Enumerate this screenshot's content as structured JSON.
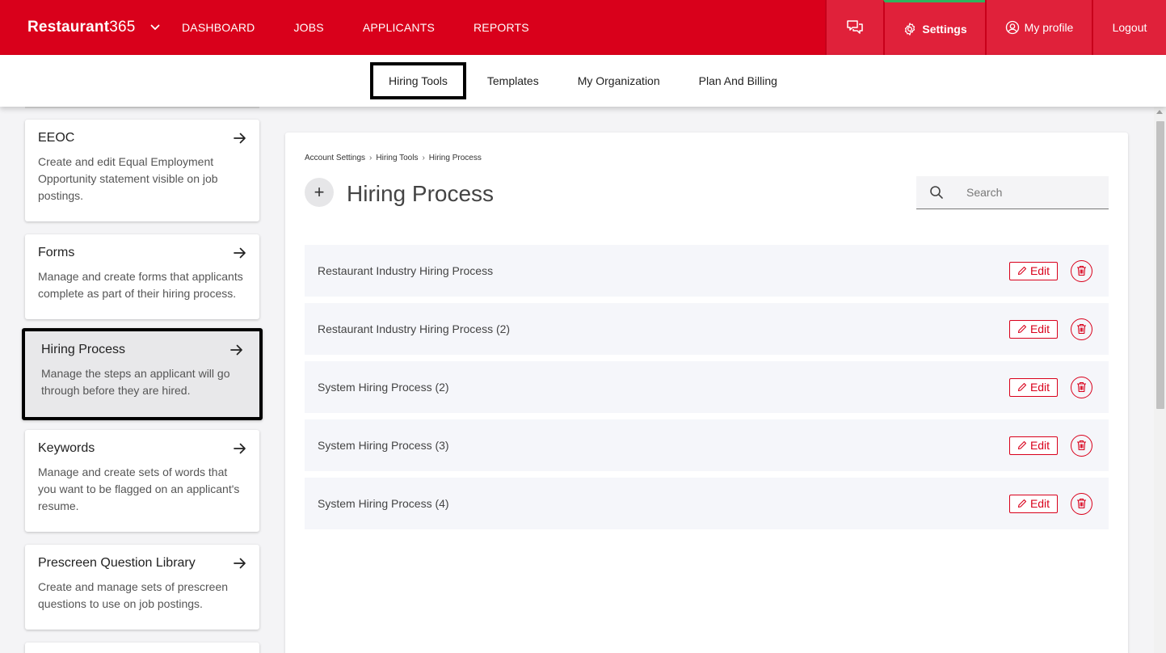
{
  "brand": {
    "name_bold": "Restaurant",
    "name_light": "365"
  },
  "nav": {
    "links": [
      "DASHBOARD",
      "JOBS",
      "APPLICANTS",
      "REPORTS"
    ],
    "settings": "Settings",
    "profile": "My profile",
    "logout": "Logout"
  },
  "subnav": {
    "items": [
      "Hiring Tools",
      "Templates",
      "My Organization",
      "Plan And Billing"
    ],
    "active": "Hiring Tools"
  },
  "sidebar": {
    "cards": [
      {
        "title": "EEOC",
        "desc": "Create and edit Equal Employment Opportunity statement visible on job postings."
      },
      {
        "title": "Forms",
        "desc": "Manage and create forms that applicants complete as part of their hiring process."
      },
      {
        "title": "Hiring Process",
        "desc": "Manage the steps an applicant will go through before they are hired."
      },
      {
        "title": "Keywords",
        "desc": "Manage and create sets of words that you want to be flagged on an applicant's resume."
      },
      {
        "title": "Prescreen Question Library",
        "desc": "Create and manage sets of prescreen questions to use on job postings."
      }
    ],
    "active": "Hiring Process"
  },
  "main": {
    "breadcrumb": [
      "Account Settings",
      "Hiring Tools",
      "Hiring Process"
    ],
    "title": "Hiring Process",
    "add_label": "+",
    "search_placeholder": "Search",
    "edit_label": "Edit",
    "rows": [
      "Restaurant Industry Hiring Process",
      "Restaurant Industry Hiring Process (2)",
      "System Hiring Process (2)",
      "System Hiring Process (3)",
      "System Hiring Process (4)"
    ]
  },
  "colors": {
    "brand_red": "#d9001b",
    "accent_green": "#2db35d"
  },
  "icons": {
    "brand_menu": "chevron-down-icon",
    "chat": "chat-bubbles-icon",
    "settings": "gear-icon",
    "profile": "user-circle-icon",
    "card_arrow": "arrow-right-icon",
    "search": "search-icon",
    "edit": "pencil-icon",
    "delete": "trash-icon"
  }
}
